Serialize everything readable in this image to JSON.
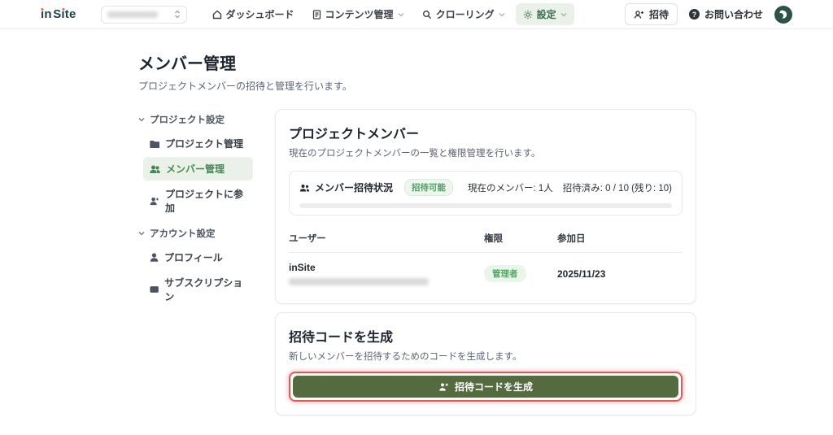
{
  "colors": {
    "brand_green": "#546a3f",
    "accent_green_text": "#4e9d5f",
    "active_pill_bg": "#e9f1e9",
    "logo_navy": "#21424a",
    "logo_dot": "#e2604e",
    "annotation_red": "#e05a56",
    "avatar_bg": "#2c524a"
  },
  "navbar": {
    "logo": "inSite",
    "items": [
      {
        "label": "ダッシュボード",
        "icon": "home",
        "chevron": false,
        "active": false
      },
      {
        "label": "コンテンツ管理",
        "icon": "document",
        "chevron": true,
        "active": false
      },
      {
        "label": "クローリング",
        "icon": "search",
        "chevron": true,
        "active": false
      },
      {
        "label": "設定",
        "icon": "gear",
        "chevron": true,
        "active": true
      }
    ],
    "invite_label": "招待",
    "help_label": "お問い合わせ",
    "help_icon": "?"
  },
  "page": {
    "title": "メンバー管理",
    "subtitle": "プロジェクトメンバーの招待と管理を行います。"
  },
  "sidebar": {
    "sections": [
      {
        "label": "プロジェクト設定",
        "items": [
          {
            "label": "プロジェクト管理",
            "icon": "folder",
            "active": false
          },
          {
            "label": "メンバー管理",
            "icon": "users",
            "active": true
          },
          {
            "label": "プロジェクトに参加",
            "icon": "user-plus",
            "active": false
          }
        ]
      },
      {
        "label": "アカウント設定",
        "items": [
          {
            "label": "プロフィール",
            "icon": "user",
            "active": false
          },
          {
            "label": "サブスクリプション",
            "icon": "credit-card",
            "active": false
          }
        ]
      }
    ]
  },
  "members_card": {
    "title": "プロジェクトメンバー",
    "subtitle": "現在のプロジェクトメンバーの一覧と権限管理を行います。",
    "status": {
      "label": "メンバー招待状況",
      "badge": "招待可能",
      "current_members": "現在のメンバー: 1人",
      "invited": "招待済み: 0 / 10 (残り: 10)",
      "progress_percent": 0
    },
    "table": {
      "headers": [
        "ユーザー",
        "権限",
        "参加日"
      ],
      "rows": [
        {
          "name": "inSite",
          "email_blurred": true,
          "role": "管理者",
          "joined": "2025/11/23"
        }
      ]
    }
  },
  "invite_card": {
    "title": "招待コードを生成",
    "subtitle": "新しいメンバーを招待するためのコードを生成します。",
    "button_label": "招待コードを生成"
  }
}
